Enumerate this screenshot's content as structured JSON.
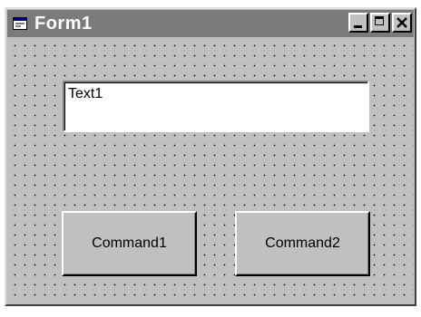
{
  "window": {
    "title": "Form1"
  },
  "titlebar": {
    "icons": {
      "app": "form-window-icon",
      "minimize": "minimize-icon",
      "maximize": "maximize-icon",
      "close": "close-icon"
    }
  },
  "form": {
    "textbox": {
      "value": "Text1"
    },
    "command1": {
      "label": "Command1"
    },
    "command2": {
      "label": "Command2"
    }
  },
  "colors": {
    "titlebar": "#7b7b7b",
    "face": "#c0c0c0",
    "grid_dot": "#000000"
  }
}
